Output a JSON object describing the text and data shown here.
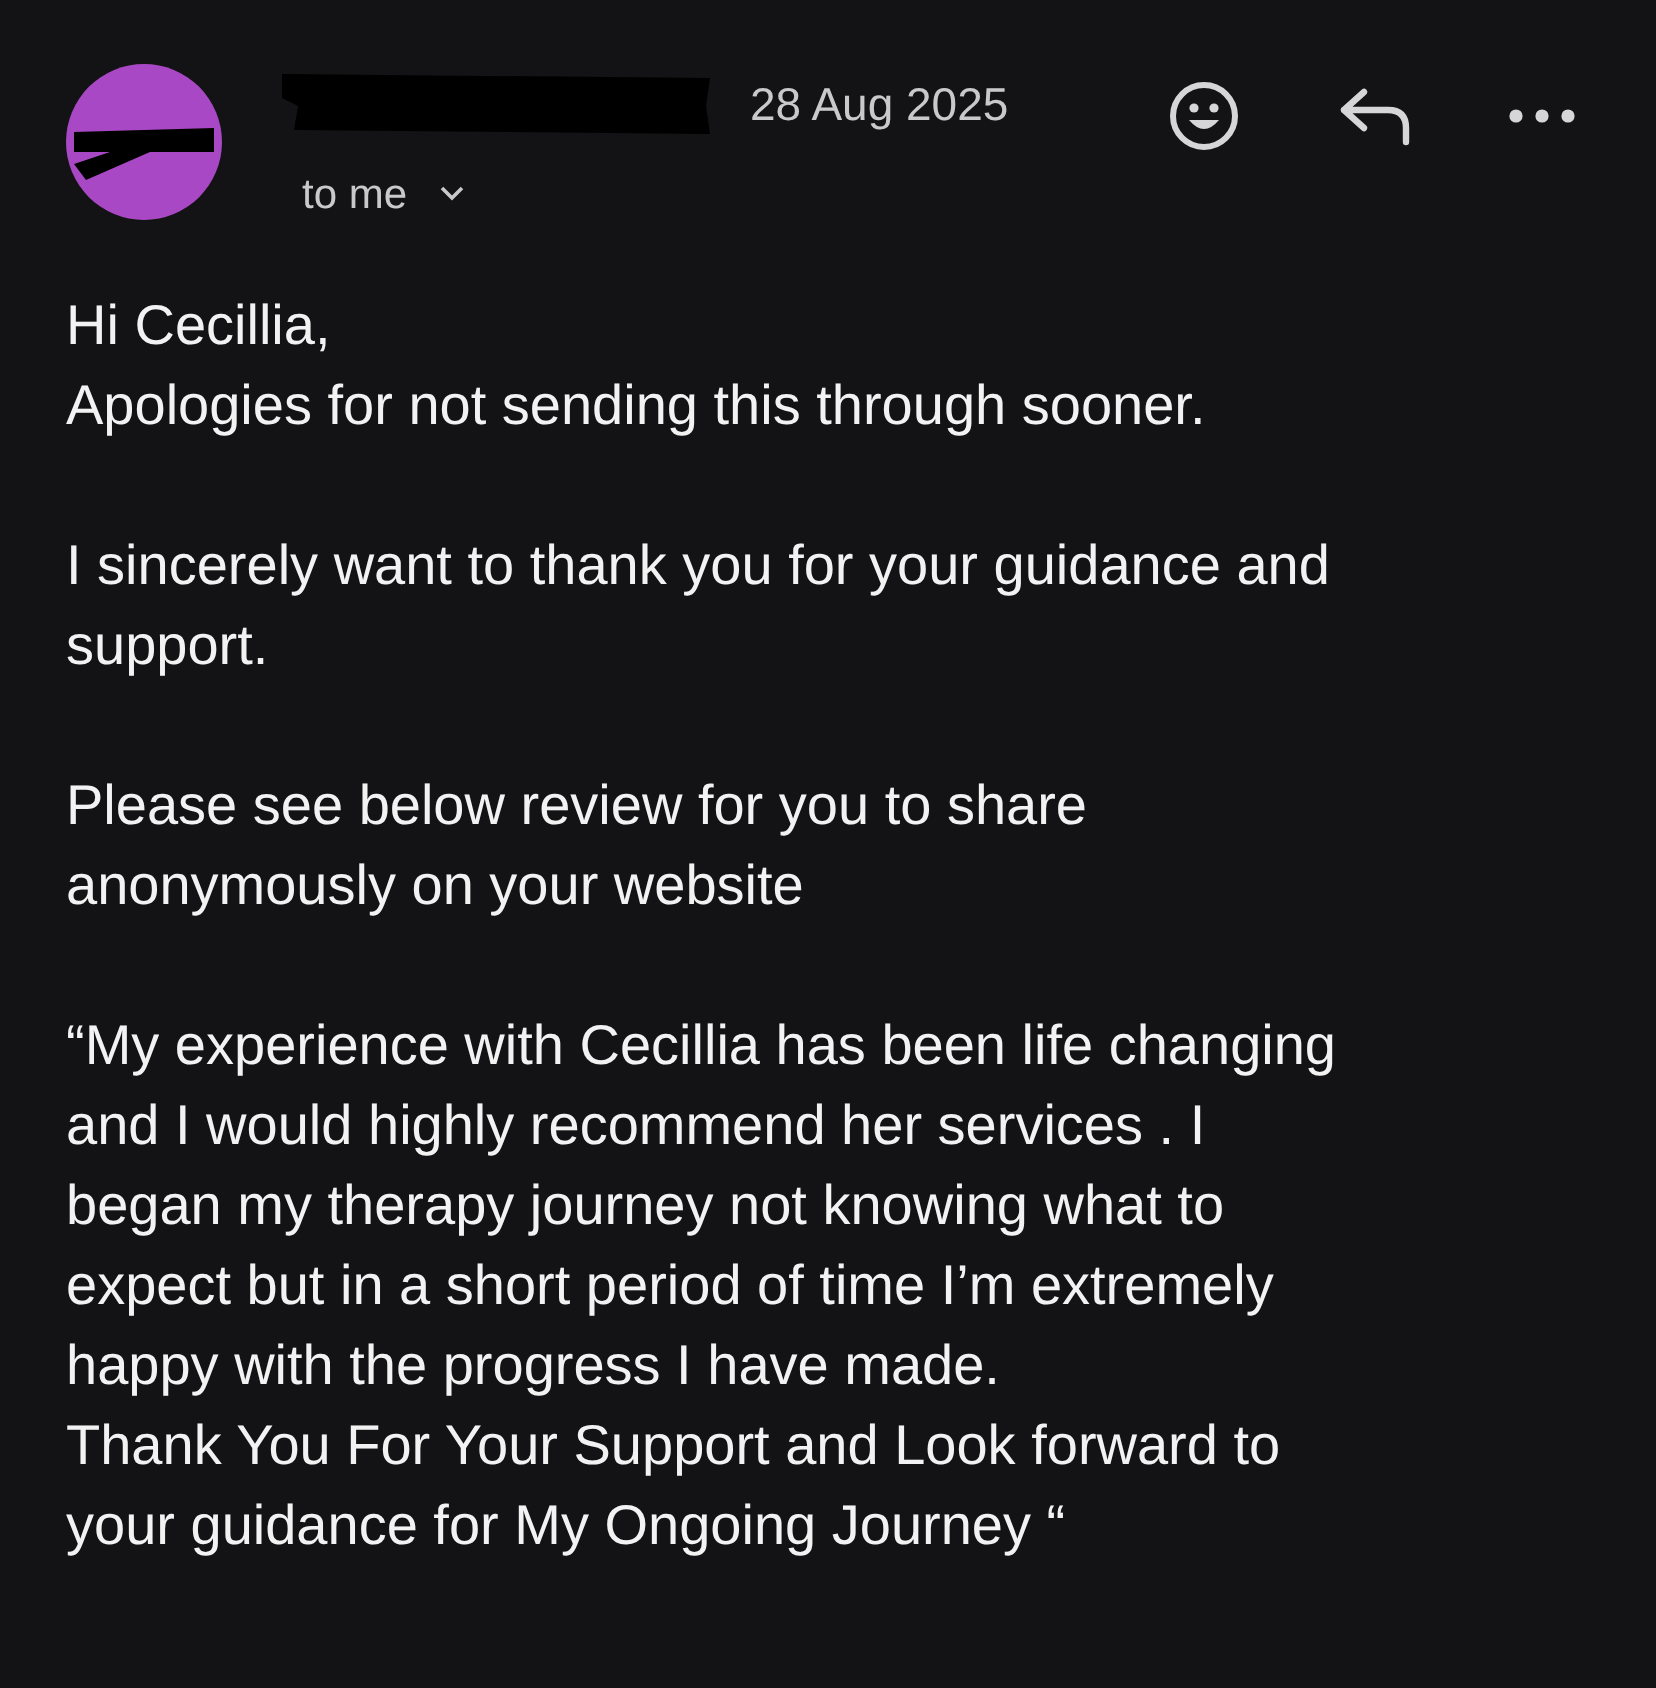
{
  "header": {
    "date": "28 Aug 2025",
    "recipient": "to me"
  },
  "body": [
    {
      "lines": [
        "Hi Cecillia,",
        "Apologies for not sending this through sooner."
      ]
    },
    {
      "lines": [
        "I sincerely want to thank you for your guidance and",
        "support."
      ]
    },
    {
      "lines": [
        "Please see below review for you to share",
        "anonymously on your website"
      ]
    },
    {
      "lines": [
        "“My experience with Cecillia has been life changing",
        "and I would highly recommend her services . I",
        "began my therapy journey not knowing what to",
        "expect but in a short period of time I’m extremely",
        "happy with the progress I have made.",
        "Thank You For Your Support and Look forward to",
        "your guidance for My Ongoing Journey “"
      ]
    }
  ]
}
